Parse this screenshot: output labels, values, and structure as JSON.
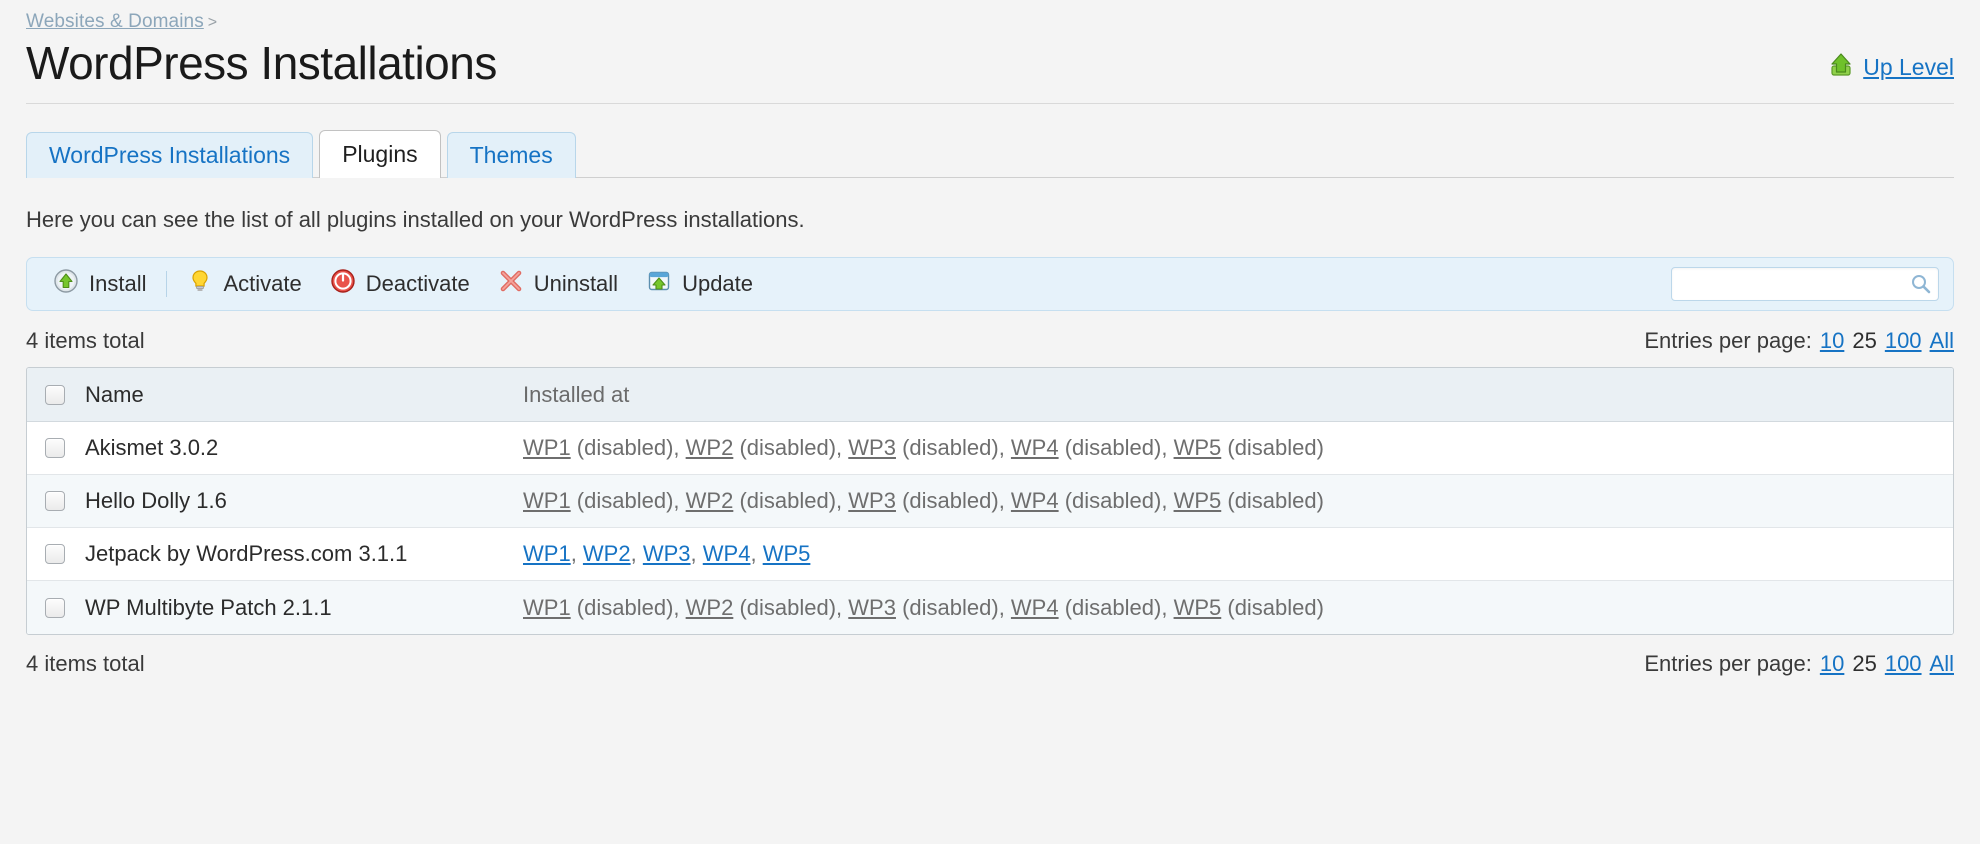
{
  "breadcrumb": {
    "link": "Websites & Domains",
    "separator": ">"
  },
  "header": {
    "title": "WordPress Installations",
    "up_level_label": "Up Level",
    "up_level_icon": "green-up-arrow-icon"
  },
  "tabs": [
    {
      "label": "WordPress Installations",
      "active": false
    },
    {
      "label": "Plugins",
      "active": true
    },
    {
      "label": "Themes",
      "active": false
    }
  ],
  "intro": "Here you can see the list of all plugins installed on your WordPress installations.",
  "toolbar": {
    "buttons": [
      {
        "label": "Install",
        "icon": "install-arrow-icon"
      },
      {
        "label": "Activate",
        "icon": "lightbulb-icon"
      },
      {
        "label": "Deactivate",
        "icon": "power-off-icon"
      },
      {
        "label": "Uninstall",
        "icon": "red-x-icon"
      },
      {
        "label": "Update",
        "icon": "window-update-icon"
      }
    ],
    "search": {
      "value": "",
      "placeholder": "",
      "icon": "search-icon"
    }
  },
  "listing": {
    "items_total_label": "4 items total",
    "entries_per_page_label": "Entries per page:",
    "entries_options": [
      {
        "label": "10",
        "selected": false
      },
      {
        "label": "25",
        "selected": true
      },
      {
        "label": "100",
        "selected": false
      },
      {
        "label": "All",
        "selected": false
      }
    ],
    "columns": {
      "name": "Name",
      "installed_at": "Installed at"
    },
    "disabled_suffix": "(disabled)",
    "rows": [
      {
        "name": "Akismet 3.0.2",
        "installations": [
          {
            "site": "WP1",
            "disabled": true
          },
          {
            "site": "WP2",
            "disabled": true
          },
          {
            "site": "WP3",
            "disabled": true
          },
          {
            "site": "WP4",
            "disabled": true
          },
          {
            "site": "WP5",
            "disabled": true
          }
        ]
      },
      {
        "name": "Hello Dolly 1.6",
        "installations": [
          {
            "site": "WP1",
            "disabled": true
          },
          {
            "site": "WP2",
            "disabled": true
          },
          {
            "site": "WP3",
            "disabled": true
          },
          {
            "site": "WP4",
            "disabled": true
          },
          {
            "site": "WP5",
            "disabled": true
          }
        ]
      },
      {
        "name": "Jetpack by WordPress.com 3.1.1",
        "installations": [
          {
            "site": "WP1",
            "disabled": false
          },
          {
            "site": "WP2",
            "disabled": false
          },
          {
            "site": "WP3",
            "disabled": false
          },
          {
            "site": "WP4",
            "disabled": false
          },
          {
            "site": "WP5",
            "disabled": false
          }
        ]
      },
      {
        "name": "WP Multibyte Patch 2.1.1",
        "installations": [
          {
            "site": "WP1",
            "disabled": true
          },
          {
            "site": "WP2",
            "disabled": true
          },
          {
            "site": "WP3",
            "disabled": true
          },
          {
            "site": "WP4",
            "disabled": true
          },
          {
            "site": "WP5",
            "disabled": true
          }
        ]
      }
    ]
  },
  "colors": {
    "page_bg": "#f4f4f4",
    "link_blue": "#1673c4",
    "toolbar_bg": "#e6f2fa",
    "tab_inactive_bg": "#e3f0f9",
    "row_alt_bg": "#f4f8fa",
    "header_row_bg": "#eaf0f4",
    "disabled_text": "#6e6e6e"
  }
}
